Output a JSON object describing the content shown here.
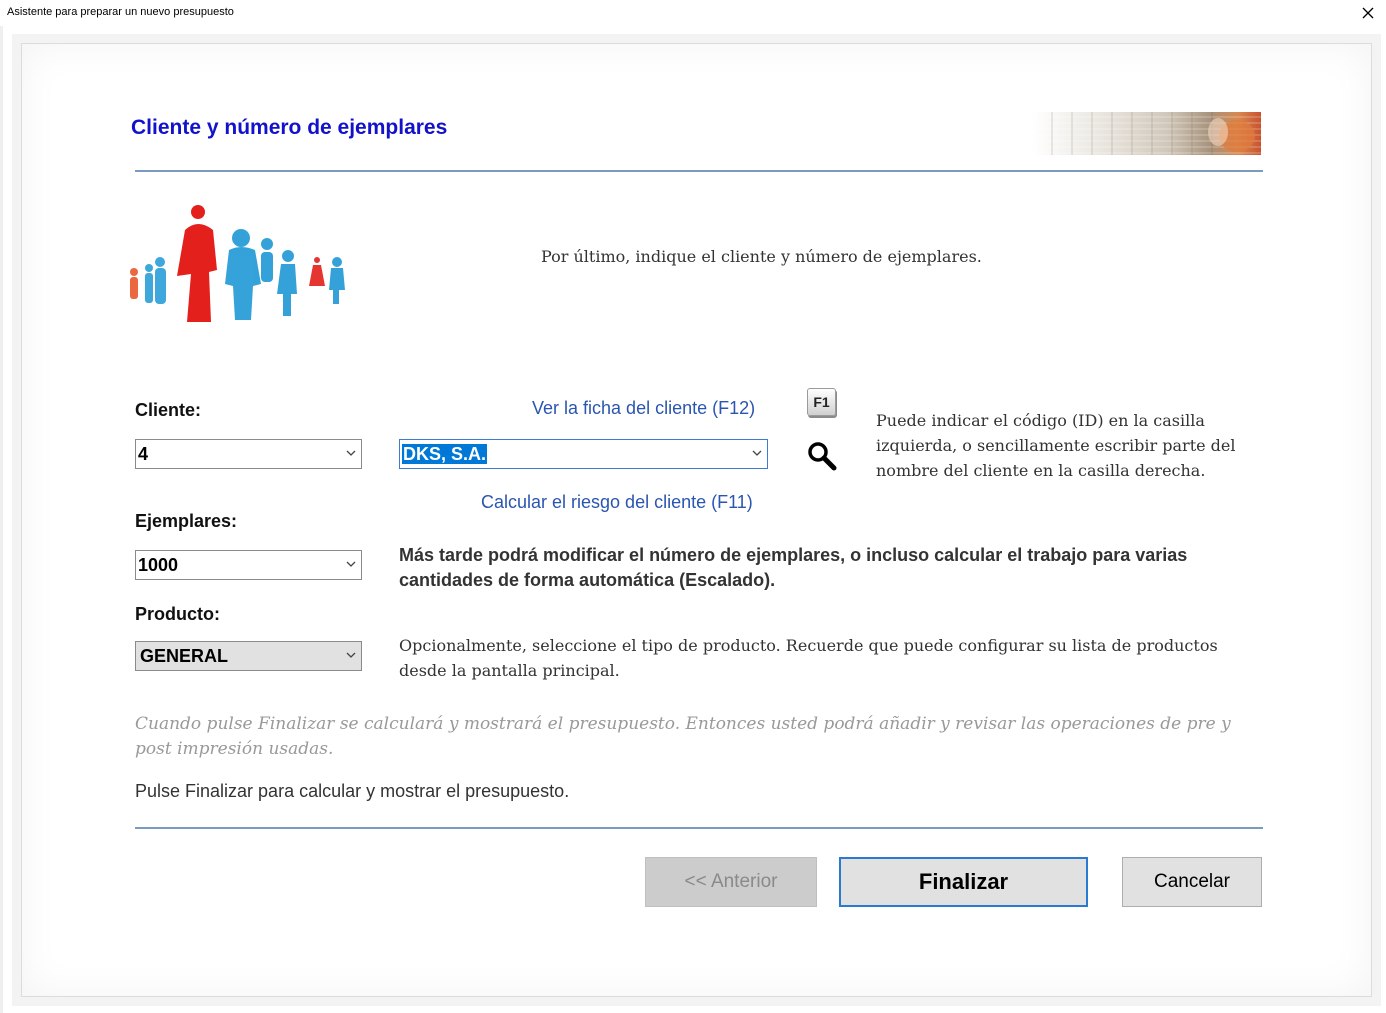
{
  "window": {
    "title": "Asistente para preparar un nuevo presupuesto"
  },
  "page": {
    "heading": "Cliente y número de ejemplares",
    "intro": "Por último, indique el cliente y número de ejemplares."
  },
  "client": {
    "label": "Cliente:",
    "id_value": "4",
    "name_value": "DKS, S.A.",
    "view_link": "Ver la ficha del cliente (F12)",
    "risk_link": "Calcular el riesgo del cliente (F11)",
    "f1_key": "F1",
    "help_text": "Puede indicar el código (ID) en la casilla izquierda, o sencillamente escribir parte del nombre del cliente en la casilla derecha."
  },
  "copies": {
    "label": "Ejemplares:",
    "value": "1000",
    "note": "Más tarde podrá modificar el número de ejemplares, o incluso calcular el trabajo para varias cantidades de forma automática (Escalado)."
  },
  "product": {
    "label": "Producto:",
    "value": "GENERAL",
    "note": "Opcionalmente, seleccione el tipo de producto. Recuerde que puede configurar su lista de productos desde la pantalla principal."
  },
  "footer": {
    "italic_note": "Cuando pulse Finalizar se calculará y mostrará el presupuesto. Entonces usted podrá añadir y revisar las operaciones de pre y post impresión usadas.",
    "final_note": "Pulse Finalizar para calcular y mostrar el presupuesto."
  },
  "buttons": {
    "previous": "<< Anterior",
    "finish": "Finalizar",
    "cancel": "Cancelar"
  },
  "icons": {
    "close": "close-icon",
    "search": "search-icon",
    "dropdown": "chevron-down-icon"
  },
  "colors": {
    "heading": "#1212cc",
    "link": "#2a55b0",
    "selection": "#0078d7",
    "rule": "#7a9bbd",
    "focus_border": "#2a7ad1"
  }
}
